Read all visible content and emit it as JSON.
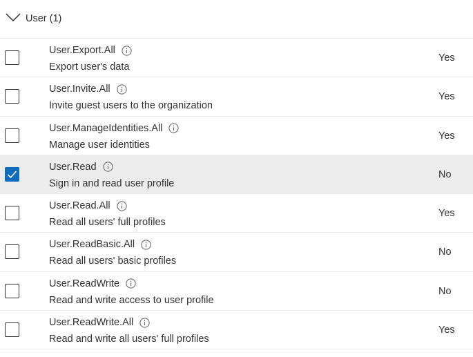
{
  "group": {
    "label": "User (1)"
  },
  "permissions": [
    {
      "name": "User.Export.All",
      "description": "Export user's data",
      "admin_consent": "Yes",
      "checked": false
    },
    {
      "name": "User.Invite.All",
      "description": "Invite guest users to the organization",
      "admin_consent": "Yes",
      "checked": false
    },
    {
      "name": "User.ManageIdentities.All",
      "description": "Manage user identities",
      "admin_consent": "Yes",
      "checked": false
    },
    {
      "name": "User.Read",
      "description": "Sign in and read user profile",
      "admin_consent": "No",
      "checked": true
    },
    {
      "name": "User.Read.All",
      "description": "Read all users' full profiles",
      "admin_consent": "Yes",
      "checked": false
    },
    {
      "name": "User.ReadBasic.All",
      "description": "Read all users' basic profiles",
      "admin_consent": "No",
      "checked": false
    },
    {
      "name": "User.ReadWrite",
      "description": "Read and write access to user profile",
      "admin_consent": "No",
      "checked": false
    },
    {
      "name": "User.ReadWrite.All",
      "description": "Read and write all users' full profiles",
      "admin_consent": "Yes",
      "checked": false
    }
  ],
  "colors": {
    "checkbox_checked": "#0f6cbd",
    "selected_row": "#ededed",
    "divider": "#edebe9"
  },
  "icons": {
    "group_toggle": "chevron-down-icon",
    "info": "info-icon",
    "check": "checkmark-icon"
  }
}
